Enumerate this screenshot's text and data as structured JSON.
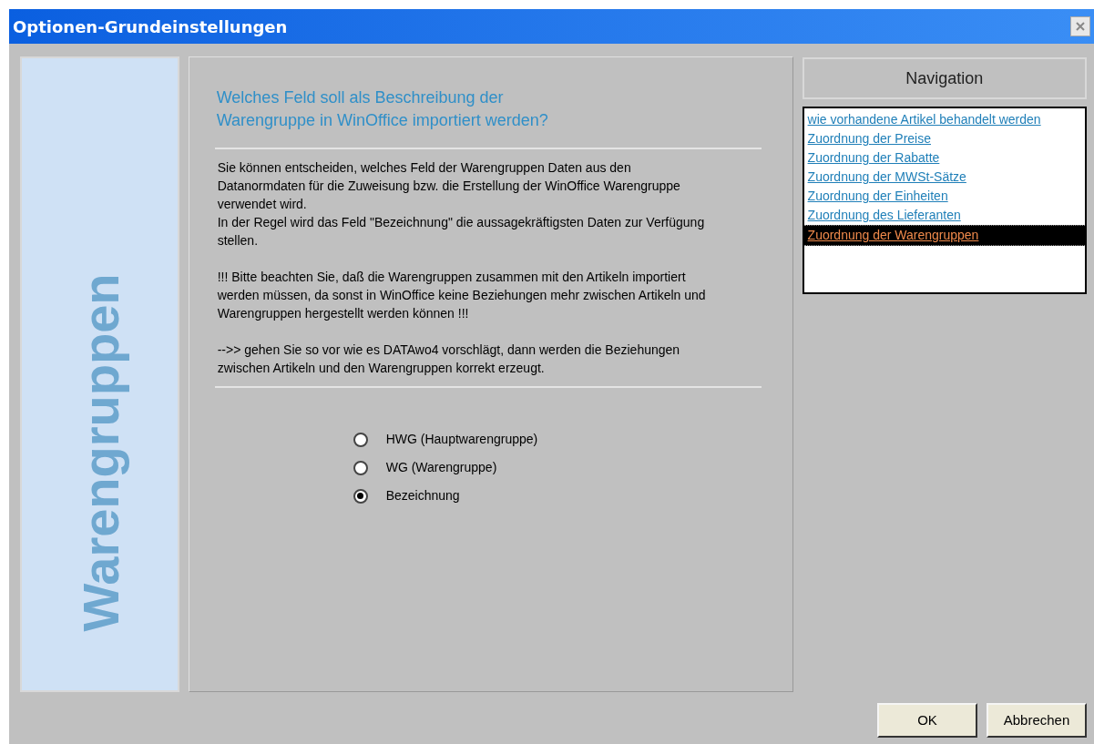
{
  "window": {
    "title": "Optionen-Grundeinstellungen"
  },
  "banner": {
    "text": "Warengruppen"
  },
  "question": {
    "lines": [
      "Welches Feld soll als Beschreibung der",
      "Warengruppe in WinOffice importiert werden?"
    ]
  },
  "description": [
    [
      "Sie können entscheiden, welches Feld der Warengruppen Daten aus den Datanormdaten für die Zuweisung bzw. die Erstellung der WinOffice Warengruppe verwendet wird.",
      "In der Regel wird das Feld \"Bezeichnung\" die aussagekräftigsten Daten zur Verfügung stellen."
    ],
    [
      "!!! Bitte beachten Sie, daß die Warengruppen zusammen mit den Artikeln importiert werden müssen, da sonst in WinOffice keine Beziehungen mehr zwischen Artikeln und Warengruppen hergestellt werden können !!!"
    ],
    [
      "-->> gehen Sie so vor wie es DATAwo4 vorschlägt, dann werden die Beziehungen zwischen Artikeln und den Warengruppen korrekt erzeugt."
    ]
  ],
  "options": [
    {
      "label": "HWG (Hauptwarengruppe)",
      "selected": false
    },
    {
      "label": "WG (Warengruppe)",
      "selected": false
    },
    {
      "label": "Bezeichnung",
      "selected": true
    }
  ],
  "navigation": {
    "title": "Navigation",
    "items": [
      {
        "label": "wie vorhandene Artikel behandelt werden",
        "selected": false
      },
      {
        "label": "Zuordnung der Preise",
        "selected": false
      },
      {
        "label": "Zuordnung der Rabatte",
        "selected": false
      },
      {
        "label": "Zuordnung der MWSt-Sätze",
        "selected": false
      },
      {
        "label": "Zuordnung der Einheiten",
        "selected": false
      },
      {
        "label": "Zuordnung des Lieferanten",
        "selected": false
      },
      {
        "label": "Zuordnung der Warengruppen",
        "selected": true
      }
    ]
  },
  "buttons": [
    "OK",
    "Abbrechen"
  ]
}
